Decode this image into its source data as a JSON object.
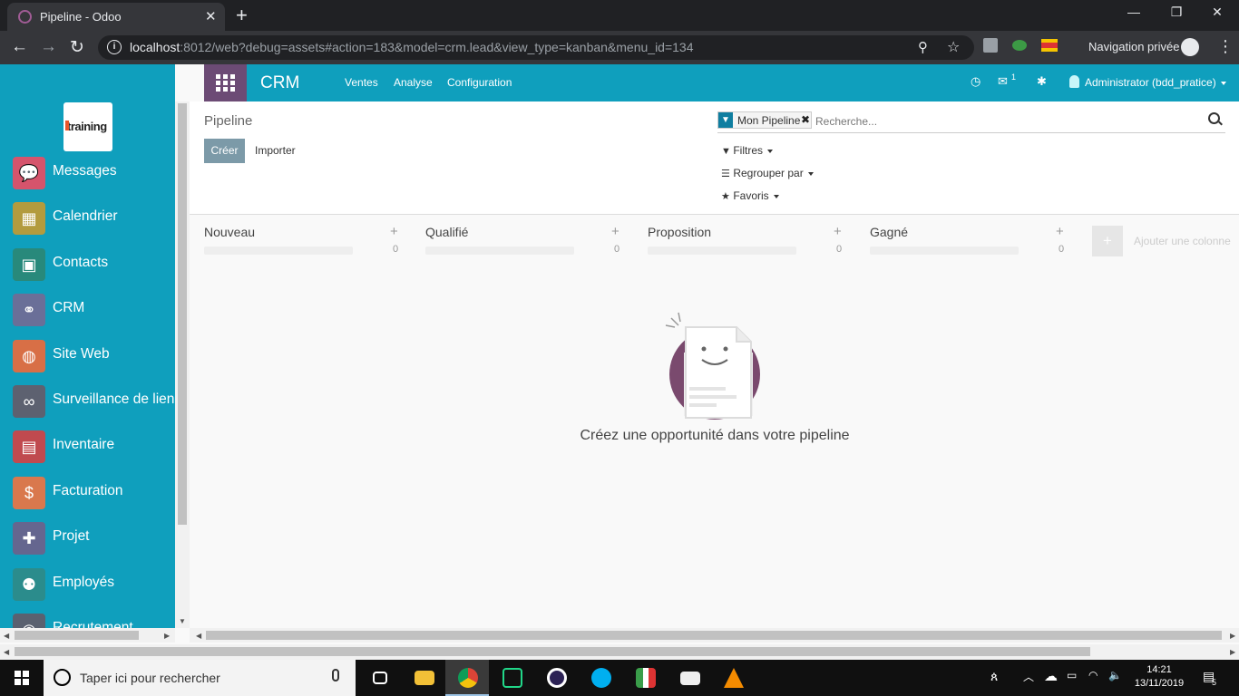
{
  "browser": {
    "tab_title": "Pipeline - Odoo",
    "url_host": "localhost",
    "url_rest": ":8012/web?debug=assets#action=183&model=crm.lead&view_type=kanban&menu_id=134",
    "private_label": "Navigation privée"
  },
  "sidebar": {
    "logo_text": "training",
    "items": [
      {
        "label": "Messages",
        "icon": "chat-icon",
        "color": "#d5546c"
      },
      {
        "label": "Calendrier",
        "icon": "calendar-icon",
        "color": "#b39b3e"
      },
      {
        "label": "Contacts",
        "icon": "contacts-icon",
        "color": "#28897b"
      },
      {
        "label": "CRM",
        "icon": "handshake-icon",
        "color": "#6a6f98"
      },
      {
        "label": "Site Web",
        "icon": "globe-icon",
        "color": "#d86f46"
      },
      {
        "label": "Surveillance de lien",
        "icon": "link-icon",
        "color": "#5d6170"
      },
      {
        "label": "Inventaire",
        "icon": "box-icon",
        "color": "#c04a4f"
      },
      {
        "label": "Facturation",
        "icon": "invoice-icon",
        "color": "#d9784d"
      },
      {
        "label": "Projet",
        "icon": "puzzle-icon",
        "color": "#65668f"
      },
      {
        "label": "Employés",
        "icon": "people-icon",
        "color": "#2b8c8c"
      },
      {
        "label": "Recrutement",
        "icon": "recruit-icon",
        "color": "#5a6170"
      }
    ]
  },
  "navbar": {
    "brand": "CRM",
    "menu": [
      "Ventes",
      "Analyse",
      "Configuration"
    ],
    "chat_count": "1",
    "user": "Administrator (bdd_pratice)"
  },
  "control_panel": {
    "breadcrumb": "Pipeline",
    "create_label": "Créer",
    "import_label": "Importer",
    "facet_label": "Mon Pipeline",
    "search_placeholder": "Recherche...",
    "filters_label": "Filtres",
    "groupby_label": "Regrouper par",
    "favorites_label": "Favoris"
  },
  "kanban": {
    "columns": [
      {
        "title": "Nouveau",
        "count": "0"
      },
      {
        "title": "Qualifié",
        "count": "0"
      },
      {
        "title": "Proposition",
        "count": "0"
      },
      {
        "title": "Gagné",
        "count": "0"
      }
    ],
    "add_column_label": "Ajouter une colonne",
    "empty_message": "Créez une opportunité dans votre pipeline"
  },
  "taskbar": {
    "search_text": "Taper ici pour rechercher",
    "time": "14:21",
    "date": "13/11/2019",
    "notif_count": "5"
  },
  "colors": {
    "primary": "#0f9fbd",
    "apps_button": "#6c4b75",
    "create_button": "#7c9aa8"
  }
}
